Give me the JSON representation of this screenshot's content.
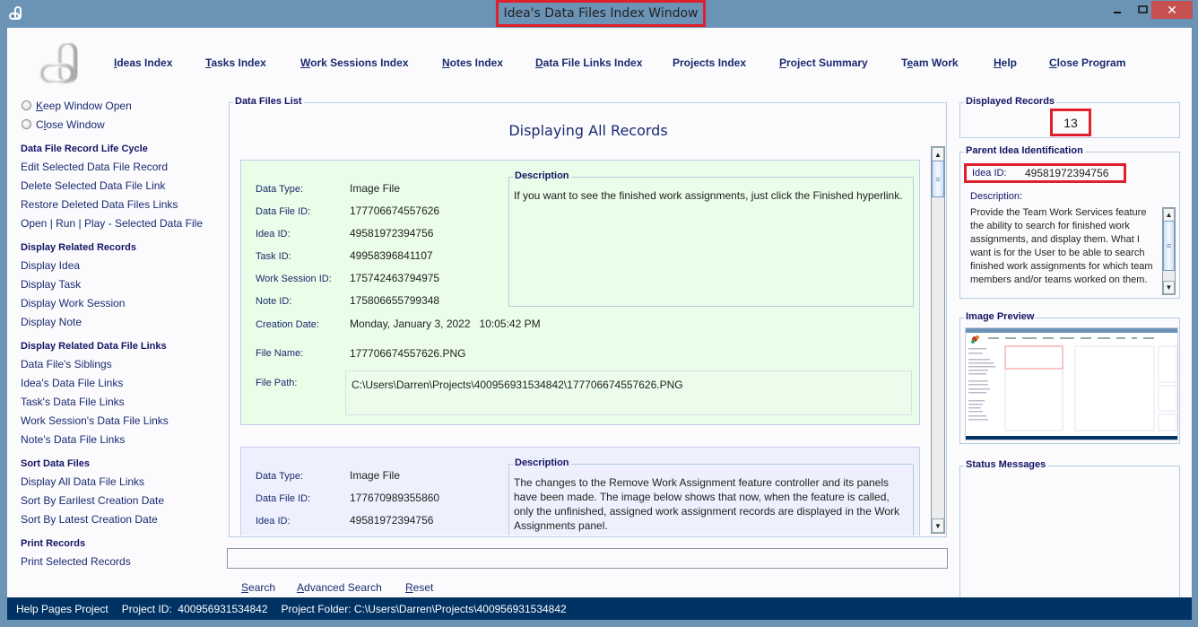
{
  "window": {
    "title": "Idea's Data Files Index Window",
    "controls": {
      "minimize": "▁",
      "maximize": "□",
      "close": "✕"
    }
  },
  "menu": [
    {
      "label": "Ideas Index",
      "mnemonic": "I",
      "rest": "deas Index"
    },
    {
      "label": "Tasks Index",
      "mnemonic": "T",
      "rest": "asks Index"
    },
    {
      "label": "Work Sessions Index",
      "mnemonic": "W",
      "rest": "ork Sessions Index"
    },
    {
      "label": "Notes Index",
      "mnemonic": "N",
      "rest": "otes Index"
    },
    {
      "label": "Data File Links Index",
      "mnemonic": "D",
      "rest": "ata File Links Index"
    },
    {
      "label": "Projects Index",
      "mnemonic": "",
      "rest": "Projects Index"
    },
    {
      "label": "Project Summary",
      "mnemonic": "P",
      "rest": "roject Summary"
    },
    {
      "label": "Team Work",
      "pre": "T",
      "mnemonic": "e",
      "rest": "am Work"
    },
    {
      "label": "Help",
      "mnemonic": "H",
      "rest": "elp"
    },
    {
      "label": "Close Program",
      "mnemonic": "C",
      "rest": "lose Program"
    }
  ],
  "sidebar": {
    "radios": [
      {
        "label": "Keep Window Open",
        "mnemonic": "K",
        "rest": "eep Window Open",
        "checked": false
      },
      {
        "label": "Close Window",
        "pre": "C",
        "mnemonic": "l",
        "rest": "ose Window",
        "checked": false
      }
    ],
    "sections": [
      {
        "heading": "Data File Record Life Cycle",
        "items": [
          "Edit Selected Data File Record",
          "Delete Selected Data File Link",
          "Restore Deleted Data Files Links",
          "Open | Run | Play - Selected Data File"
        ]
      },
      {
        "heading": "Display Related Records",
        "items": [
          "Display Idea",
          "Display Task",
          "Display Work Session",
          "Display Note"
        ]
      },
      {
        "heading": "Display Related Data File Links",
        "items": [
          "Data File's Siblings",
          "Idea's Data File Links",
          "Task's Data File Links",
          "Work Session's Data File Links",
          "Note's Data File Links"
        ]
      },
      {
        "heading": "Sort Data Files",
        "items": [
          "Display All Data File Links",
          "Sort By Earilest Creation Date",
          "Sort By Latest Creation Date"
        ]
      },
      {
        "heading": "Print Records",
        "items": [
          "Print Selected Records"
        ]
      }
    ]
  },
  "data_files_list": {
    "legend": "Data Files List",
    "heading": "Displaying All Records",
    "labels": {
      "data_type": "Data Type:",
      "data_file_id": "Data File ID:",
      "idea_id": "Idea ID:",
      "task_id": "Task ID:",
      "work_session_id": "Work Session ID:",
      "note_id": "Note ID:",
      "creation_date": "Creation Date:",
      "file_name": "File Name:",
      "file_path": "File Path:",
      "description": "Description"
    },
    "records": [
      {
        "data_type": "Image File",
        "data_file_id": "177706674557626",
        "idea_id": "49581972394756",
        "task_id": "49958396841107",
        "work_session_id": "175742463794975",
        "note_id": "175806655799348",
        "creation_date": "Monday, January 3, 2022   10:05:42 PM",
        "file_name": "177706674557626.PNG",
        "file_path": "C:\\Users\\Darren\\Projects\\400956931534842\\177706674557626.PNG",
        "description": "If you want to see the finished work assignments, just click the Finished hyperlink."
      },
      {
        "data_type": "Image File",
        "data_file_id": "177670989355860",
        "idea_id": "49581972394756",
        "description": "The changes to the Remove Work Assignment feature controller and its panels have been made. The image below shows that now, when the feature is called, only the unfinished, assigned work assignment records are displayed in the Work Assignments panel."
      }
    ]
  },
  "search": {
    "value": "",
    "placeholder": "",
    "buttons": [
      {
        "label": "Search",
        "mnemonic": "S",
        "rest": "earch"
      },
      {
        "label": "Advanced Search",
        "mnemonic": "A",
        "rest": "dvanced Search"
      },
      {
        "label": "Reset",
        "mnemonic": "R",
        "rest": "eset"
      }
    ]
  },
  "right_panel": {
    "displayed_records": {
      "legend": "Displayed Records",
      "count": "13"
    },
    "parent_idea": {
      "legend": "Parent Idea Identification",
      "id_label": "Idea ID:",
      "id_value": "49581972394756",
      "description_label": "Description:",
      "description": "Provide the Team Work Services feature the ability to search for finished work assignments, and display them. What I want is for the User to be able to search finished work assignments for which team members and/or teams worked on them."
    },
    "image_preview": {
      "legend": "Image Preview"
    },
    "status_messages": {
      "legend": "Status Messages",
      "text": ""
    }
  },
  "statusbar": {
    "project_name": "Help Pages Project",
    "project_id": "Project ID:  400956931534842",
    "project_folder": "Project Folder: C:\\Users\\Darren\\Projects\\400956931534842"
  },
  "colors": {
    "titlebar": "#6b93b6",
    "highlight": "#e0202a",
    "statusbar": "#003264",
    "record_green": "#e9fde8",
    "record_blue": "#eef1fd",
    "link_text": "#1a2a6e"
  }
}
